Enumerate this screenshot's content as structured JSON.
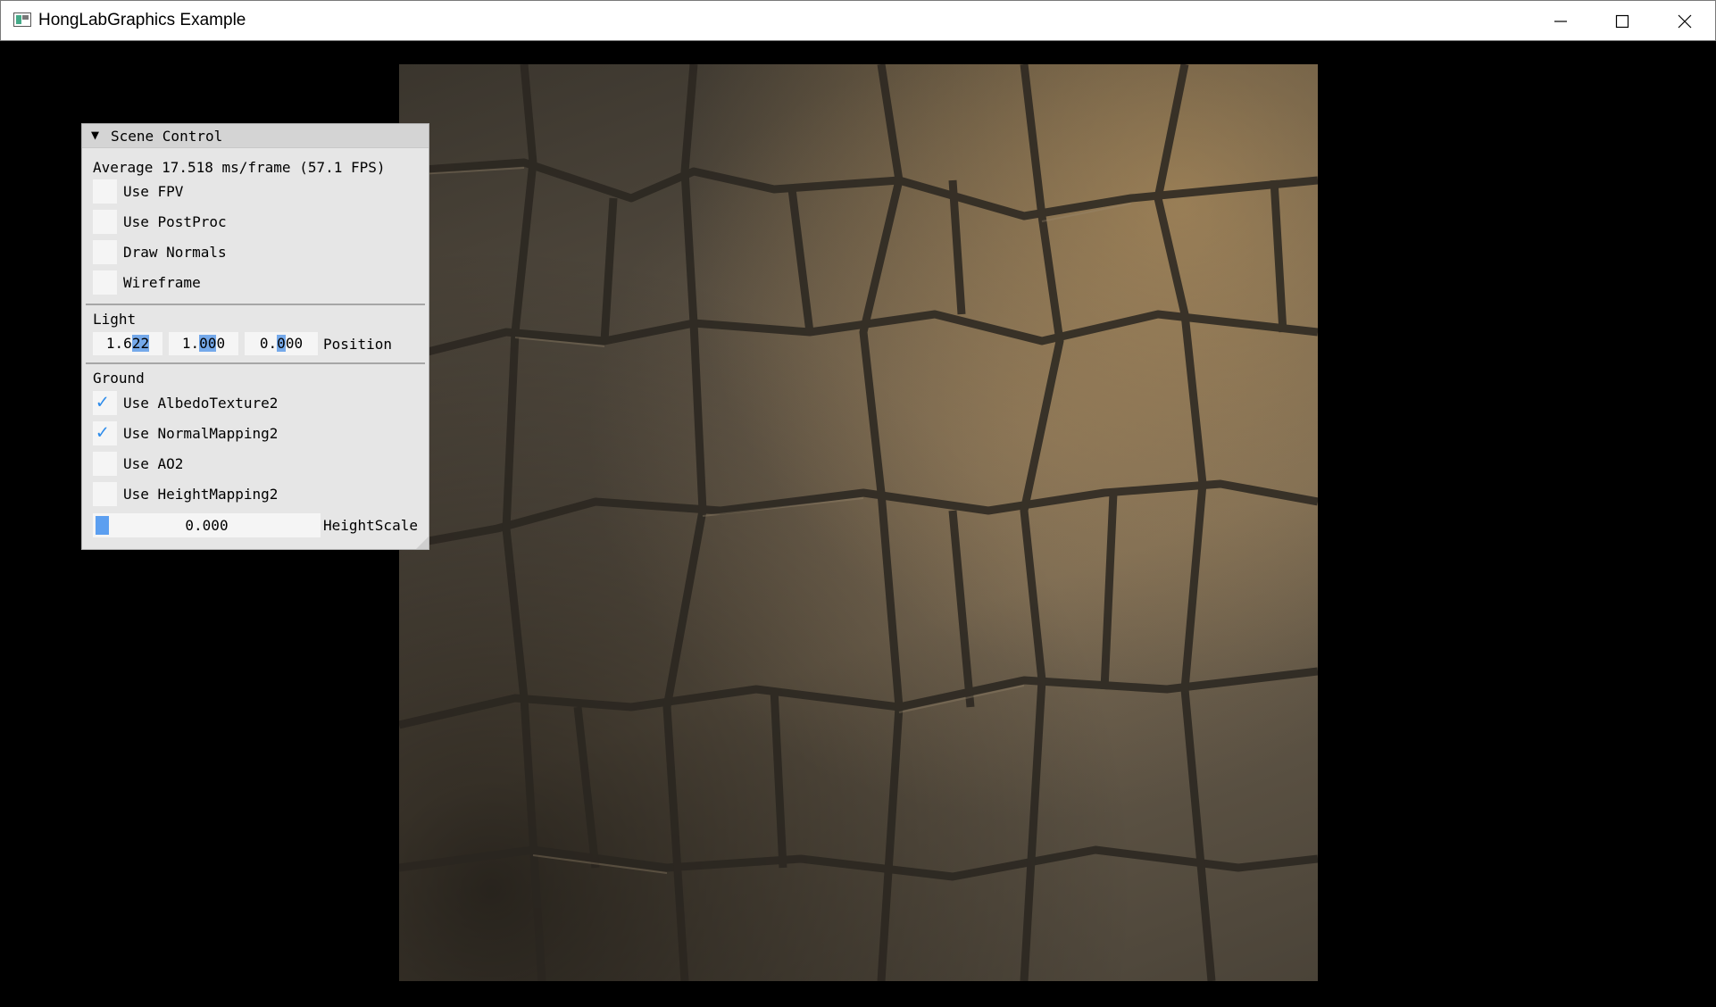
{
  "window": {
    "title": "HongLabGraphics Example",
    "controls": {
      "minimize": "minimize-icon",
      "maximize": "maximize-icon",
      "close": "close-icon"
    }
  },
  "panel": {
    "title": "Scene Control",
    "stats": "Average 17.518 ms/frame (57.1 FPS)",
    "checkboxes": [
      {
        "label": "Use FPV",
        "checked": false
      },
      {
        "label": "Use PostProc",
        "checked": false
      },
      {
        "label": "Draw Normals",
        "checked": false
      },
      {
        "label": "Wireframe",
        "checked": false
      }
    ],
    "light": {
      "header": "Light",
      "position": {
        "x_pre": "1.6",
        "x_sel": "22",
        "y_pre": "1.",
        "y_sel": "00",
        "y_post": "0",
        "z_pre": "0.",
        "z_sel": "0",
        "z_post": "00",
        "label": "Position"
      }
    },
    "ground": {
      "header": "Ground",
      "checkboxes": [
        {
          "label": "Use AlbedoTexture2",
          "checked": true
        },
        {
          "label": "Use NormalMapping2",
          "checked": true
        },
        {
          "label": "Use AO2",
          "checked": false
        },
        {
          "label": "Use HeightMapping2",
          "checked": false
        }
      ],
      "height_scale": {
        "value": "0.000",
        "label": "HeightScale",
        "fraction": 0.0
      }
    }
  },
  "colors": {
    "check": "#2d8ceb",
    "selection": "#75a9ea",
    "slider_grab": "#5c9ff0"
  }
}
